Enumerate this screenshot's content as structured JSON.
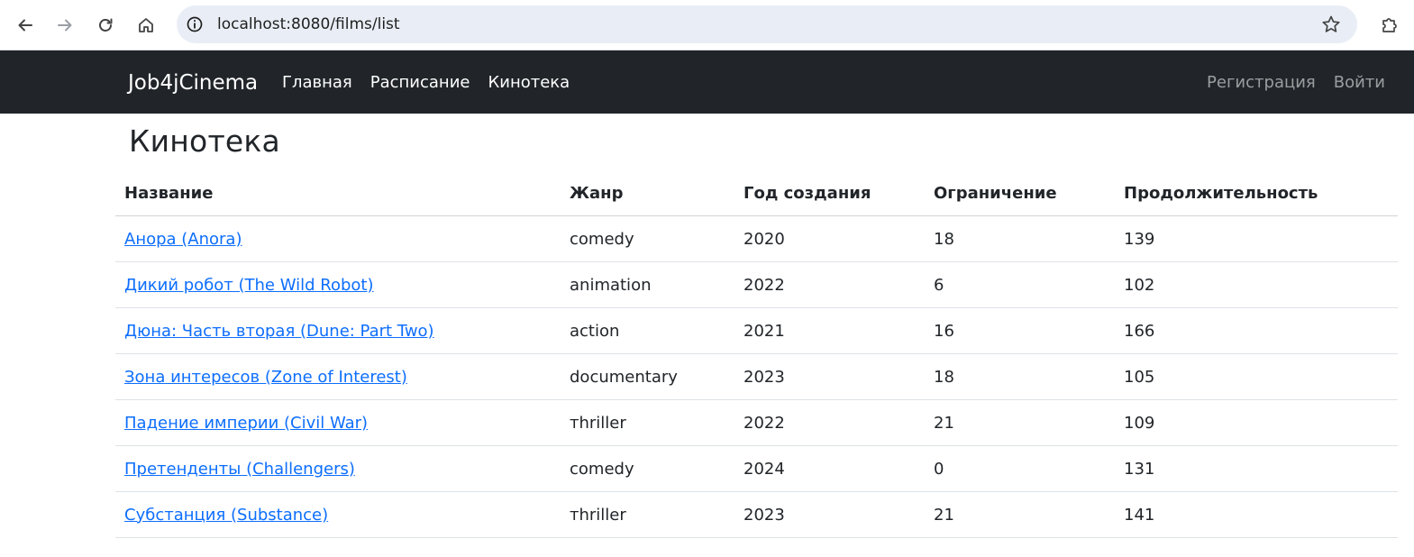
{
  "browser": {
    "url": "localhost:8080/films/list",
    "icons": {
      "back": "arrow-left-icon",
      "forward": "arrow-right-icon",
      "reload": "reload-icon",
      "home": "home-icon",
      "site_info": "info-icon",
      "bookmark": "star-icon",
      "extensions": "puzzle-icon"
    }
  },
  "navbar": {
    "brand": "Job4jCinema",
    "links": [
      "Главная",
      "Расписание",
      "Кинотека"
    ],
    "right_links": [
      "Регистрация",
      "Войти"
    ],
    "background": "#212529"
  },
  "page": {
    "title": "Кинотека"
  },
  "table": {
    "headers": [
      "Название",
      "Жанр",
      "Год создания",
      "Ограничение",
      "Продолжительность"
    ],
    "rows": [
      [
        "Анора (Anora)",
        "comedy",
        "2020",
        "18",
        "139"
      ],
      [
        "Дикий робот (The Wild Robot)",
        "animation",
        "2022",
        "6",
        "102"
      ],
      [
        "Дюна: Часть вторая (Dune: Part Two)",
        "action",
        "2021",
        "16",
        "166"
      ],
      [
        "Зона интересов (Zone of Interest)",
        "documentary",
        "2023",
        "18",
        "105"
      ],
      [
        "Падение империи (Civil War)",
        "тhriller",
        "2022",
        "21",
        "109"
      ],
      [
        "Претенденты (Challengers)",
        "comedy",
        "2024",
        "0",
        "131"
      ],
      [
        "Субстанция (Substance)",
        "тhriller",
        "2023",
        "21",
        "141"
      ]
    ],
    "link_color": "#0d6efd"
  }
}
